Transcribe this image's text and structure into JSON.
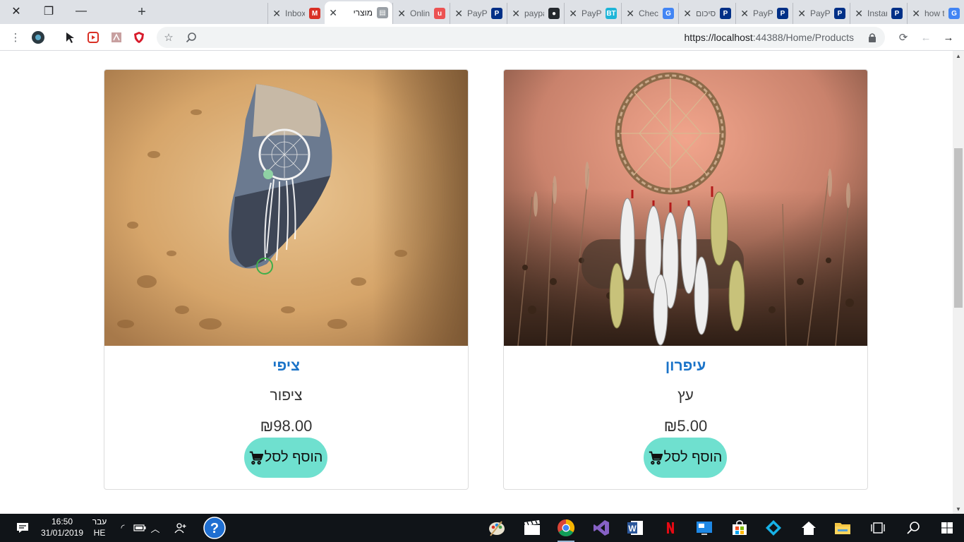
{
  "browser": {
    "tabs": [
      {
        "title": "how t",
        "favicon": "google-g-icon",
        "color": "#4285f4",
        "glyph": "G"
      },
      {
        "title": "Instar",
        "favicon": "paypal-icon",
        "color": "#003087",
        "glyph": "P"
      },
      {
        "title": "PayPa",
        "favicon": "paypal-icon",
        "color": "#003087",
        "glyph": "P"
      },
      {
        "title": "PayPa",
        "favicon": "paypal-icon",
        "color": "#003087",
        "glyph": "P"
      },
      {
        "title": "סיכום",
        "favicon": "paypal-icon",
        "color": "#003087",
        "glyph": "P"
      },
      {
        "title": "Check",
        "favicon": "google-g-icon",
        "color": "#4285f4",
        "glyph": "G"
      },
      {
        "title": "PayPa",
        "favicon": "braintree-icon",
        "color": "#1fb5d8",
        "glyph": "BT"
      },
      {
        "title": "paypa",
        "favicon": "github-icon",
        "color": "#24292e",
        "glyph": "●"
      },
      {
        "title": "PayPa",
        "favicon": "paypal-icon",
        "color": "#003087",
        "glyph": "P"
      },
      {
        "title": "Onlin",
        "favicon": "udemy-icon",
        "color": "#ec5252",
        "glyph": "u"
      },
      {
        "title": "מוצרי",
        "favicon": "page-icon",
        "color": "#9aa0a6",
        "glyph": "▤"
      },
      {
        "title": "Inbox",
        "favicon": "gmail-icon",
        "color": "#d93025",
        "glyph": "M"
      }
    ],
    "url_host": "https://localhost",
    "url_rest": ":44388/Home/Products"
  },
  "products": [
    {
      "name": "ציפי",
      "subtitle": "ציפור",
      "price": "₪98.00",
      "button": "הוסף לסל"
    },
    {
      "name": "עיפרון",
      "subtitle": "עץ",
      "price": "₪5.00",
      "button": "הוסף לסל"
    }
  ],
  "taskbar": {
    "time": "16:50",
    "date": "31/01/2019",
    "lang_top": "עבר",
    "lang_bottom": "HE"
  }
}
